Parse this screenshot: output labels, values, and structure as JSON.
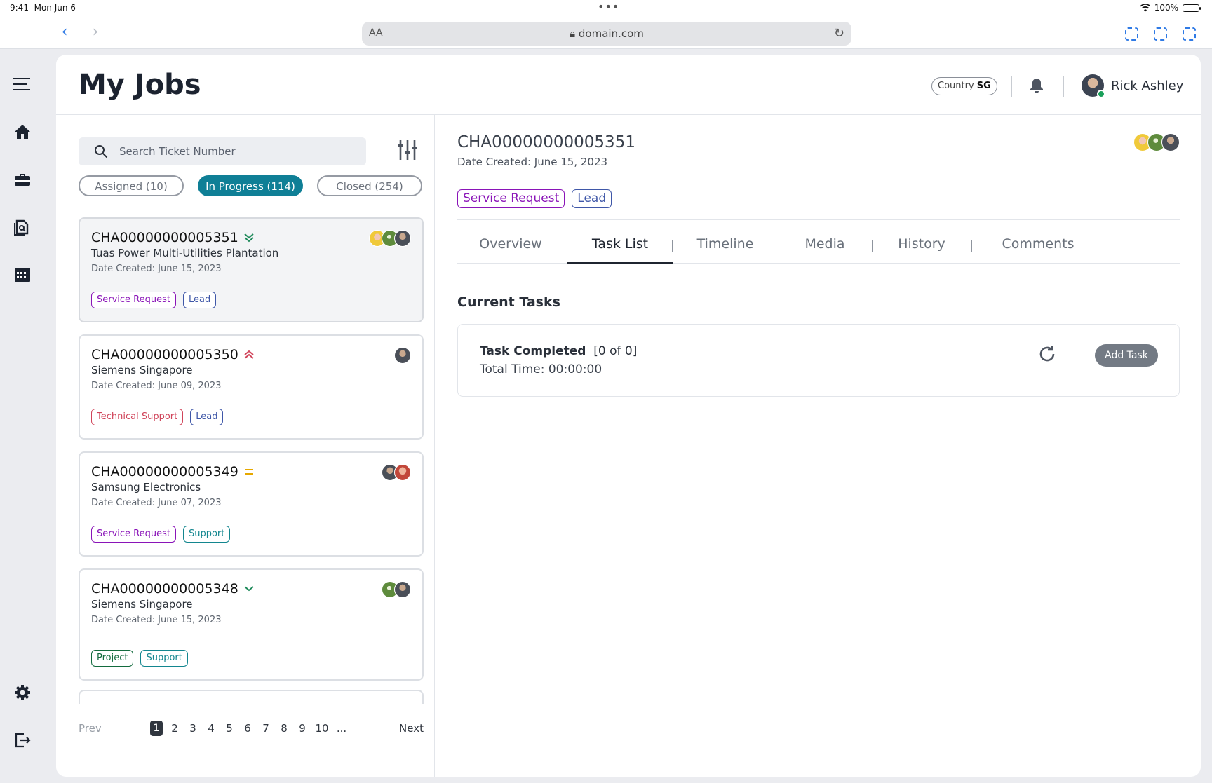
{
  "status_bar": {
    "time": "9:41",
    "date": "Mon Jun 6",
    "battery": "100%"
  },
  "browser": {
    "url": "domain.com",
    "aa_label": "AA"
  },
  "header": {
    "title": "My Jobs",
    "country_label": "Country",
    "country_code": "SG",
    "user_name": "Rick Ashley"
  },
  "search": {
    "placeholder": "Search Ticket Number"
  },
  "filters": [
    {
      "label": "Assigned (10)",
      "active": false
    },
    {
      "label": "In Progress (114)",
      "active": true
    },
    {
      "label": "Closed (254)",
      "active": false
    }
  ],
  "tickets": [
    {
      "id": "CHA00000000005351",
      "customer": "Tuas Power Multi-Utilities Plantation",
      "date": "Date Created: June 15, 2023",
      "priority": "double-chevron-down-icon",
      "tags": [
        {
          "label": "Service Request",
          "color": "#8a14b8"
        },
        {
          "label": "Lead",
          "color": "#3f57a8"
        }
      ]
    },
    {
      "id": "CHA00000000005350",
      "customer": "Siemens Singapore",
      "date": "Date Created: June 09, 2023",
      "priority": "double-chevron-up-icon",
      "tags": [
        {
          "label": "Technical Support",
          "color": "#d0445a"
        },
        {
          "label": "Lead",
          "color": "#3f57a8"
        }
      ]
    },
    {
      "id": "CHA00000000005349",
      "customer": "Samsung Electronics",
      "date": "Date Created: June 07, 2023",
      "priority": "equals-icon",
      "tags": [
        {
          "label": "Service Request",
          "color": "#8a14b8"
        },
        {
          "label": "Support",
          "color": "#13868f"
        }
      ]
    },
    {
      "id": "CHA00000000005348",
      "customer": "Siemens Singapore",
      "date": "Date Created: June 15, 2023",
      "priority": "chevron-down-icon",
      "tags": [
        {
          "label": "Project",
          "color": "#136b3e"
        },
        {
          "label": "Support",
          "color": "#13868f"
        }
      ]
    }
  ],
  "pagination": {
    "prev": "Prev",
    "next": "Next",
    "pages": [
      "1",
      "2",
      "3",
      "4",
      "5",
      "6",
      "7",
      "8",
      "9",
      "10",
      "..."
    ],
    "current": "1"
  },
  "detail": {
    "id": "CHA00000000005351",
    "date": "Date Created: June 15, 2023",
    "tags": [
      {
        "label": "Service Request",
        "color": "#8a14b8"
      },
      {
        "label": "Lead",
        "color": "#3f57a8"
      }
    ],
    "tabs": [
      "Overview",
      "Task List",
      "Timeline",
      "Media",
      "History",
      "Comments"
    ],
    "active_tab": "Task List",
    "section_title": "Current Tasks",
    "task_completed_label": "Task Completed",
    "task_completed_value": "[0 of 0]",
    "total_time": "Total Time: 00:00:00",
    "add_task_label": "Add Task"
  },
  "colors": {
    "accent": "#0f7f96",
    "text": "#1f2530",
    "online": "#1aa05a"
  }
}
